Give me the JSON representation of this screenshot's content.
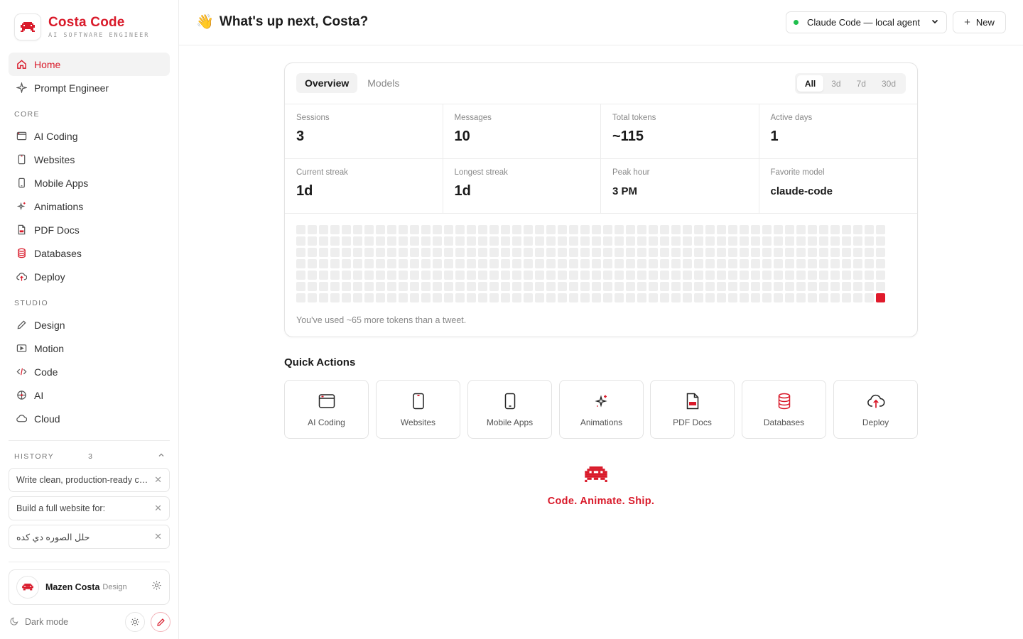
{
  "brand": {
    "title": "Costa Code",
    "subtitle": "AI SOFTWARE ENGINEER",
    "accent": "#d91a2a"
  },
  "nav": {
    "home": "Home",
    "prompt_engineer": "Prompt Engineer",
    "core_label": "CORE",
    "core": [
      "AI Coding",
      "Websites",
      "Mobile Apps",
      "Animations",
      "PDF Docs",
      "Databases",
      "Deploy"
    ],
    "studio_label": "STUDIO",
    "studio": [
      "Design",
      "Motion",
      "Code",
      "AI",
      "Cloud"
    ]
  },
  "history": {
    "label": "HISTORY",
    "count": "3",
    "items": [
      "Write clean, production-ready code for:",
      "Build a full website for:",
      "حلل الصوره دي كده"
    ]
  },
  "user": {
    "name": "Mazen Costa",
    "role": "Design",
    "dark_mode": "Dark mode"
  },
  "header": {
    "wave": "👋",
    "greeting": "What's up next, Costa?",
    "agent": "Claude Code — local agent",
    "new_label": "New"
  },
  "overview": {
    "tabs": [
      "Overview",
      "Models"
    ],
    "ranges": [
      "All",
      "3d",
      "7d",
      "30d"
    ],
    "stats": [
      {
        "label": "Sessions",
        "value": "3"
      },
      {
        "label": "Messages",
        "value": "10"
      },
      {
        "label": "Total tokens",
        "value": "~115"
      },
      {
        "label": "Active days",
        "value": "1"
      },
      {
        "label": "Current streak",
        "value": "1d"
      },
      {
        "label": "Longest streak",
        "value": "1d"
      },
      {
        "label": "Peak hour",
        "value": "3 PM"
      },
      {
        "label": "Favorite model",
        "value": "claude-code"
      }
    ],
    "activity": {
      "weeks": 52,
      "days": 7,
      "active_week": 52,
      "active_day": 7
    },
    "note": "You've used ~65 more tokens than a tweet."
  },
  "quick_actions": {
    "title": "Quick Actions",
    "items": [
      {
        "label": "AI Coding",
        "icon": "browser-window-icon"
      },
      {
        "label": "Websites",
        "icon": "tablet-icon"
      },
      {
        "label": "Mobile Apps",
        "icon": "phone-icon"
      },
      {
        "label": "Animations",
        "icon": "sparkle-icon"
      },
      {
        "label": "PDF Docs",
        "icon": "pdf-icon"
      },
      {
        "label": "Databases",
        "icon": "database-icon"
      },
      {
        "label": "Deploy",
        "icon": "cloud-upload-icon"
      }
    ]
  },
  "tagline": "Code. Animate. Ship."
}
